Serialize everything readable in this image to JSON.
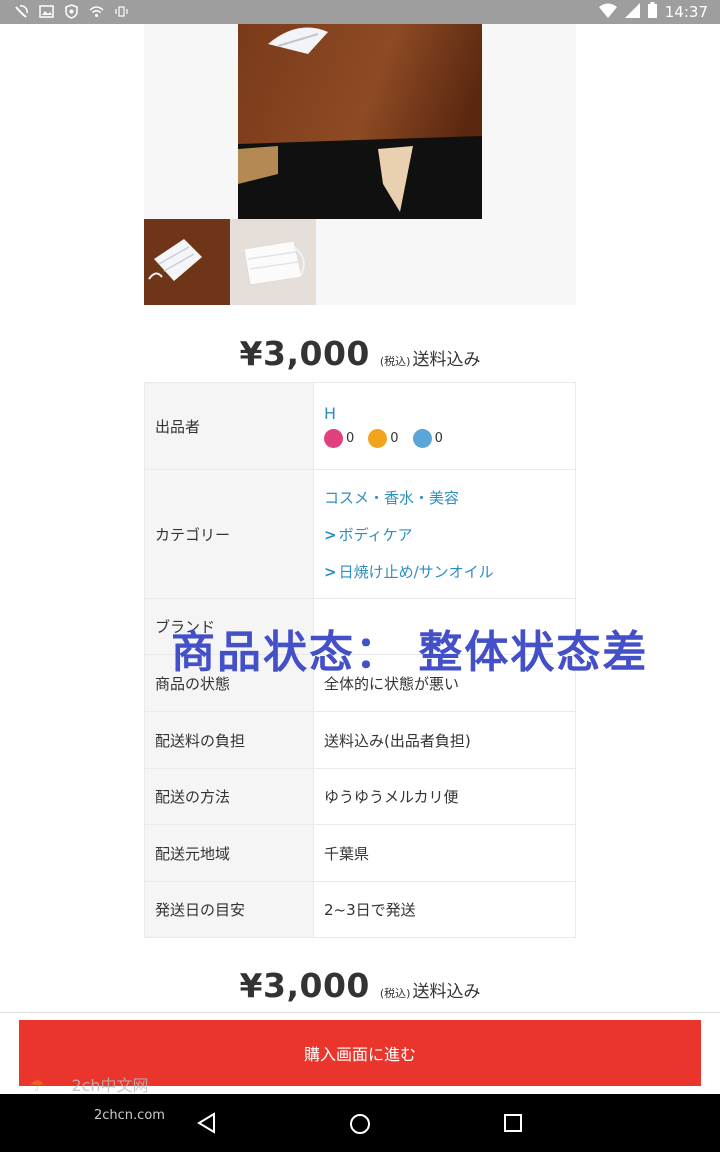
{
  "status_bar": {
    "time": "14:37",
    "icons": [
      "wifi-calling-icon",
      "image-icon",
      "shield-icon",
      "wifi-alert-icon",
      "vibrate-icon",
      "wifi-icon",
      "signal-icon",
      "battery-icon"
    ]
  },
  "item": {
    "price": "¥3,000",
    "tax_label": "(税込)",
    "shipping_label": "送料込み"
  },
  "details": {
    "seller": {
      "label": "出品者",
      "name": "H",
      "ratings": {
        "good": "0",
        "normal": "0",
        "bad": "0"
      }
    },
    "category": {
      "label": "カテゴリー",
      "level1": "コスメ・香水・美容",
      "level2": "ボディケア",
      "level3": "日焼け止め/サンオイル"
    },
    "brand": {
      "label": "ブランド"
    },
    "condition": {
      "label": "商品の状態",
      "value": "全体的に状態が悪い"
    },
    "shipping_fee": {
      "label": "配送料の負担",
      "value": "送料込み(出品者負担)"
    },
    "shipping_method": {
      "label": "配送の方法",
      "value": "ゆうゆうメルカリ便"
    },
    "ship_from": {
      "label": "配送元地域",
      "value": "千葉県"
    },
    "ship_days": {
      "label": "発送日の目安",
      "value": "2~3日で発送"
    }
  },
  "overlay": {
    "text": "商品状态： 整体状态差"
  },
  "purchase": {
    "button_label": "購入画面に進む"
  },
  "watermark": {
    "line1": "2ch中文网",
    "line2": "2chcn.com"
  },
  "colors": {
    "link": "#2d8fc1",
    "buy_button": "#ea352d",
    "overlay_text": "#4350c8",
    "good": "#e0407f",
    "normal": "#f2a41d",
    "bad": "#5aa6d6"
  }
}
